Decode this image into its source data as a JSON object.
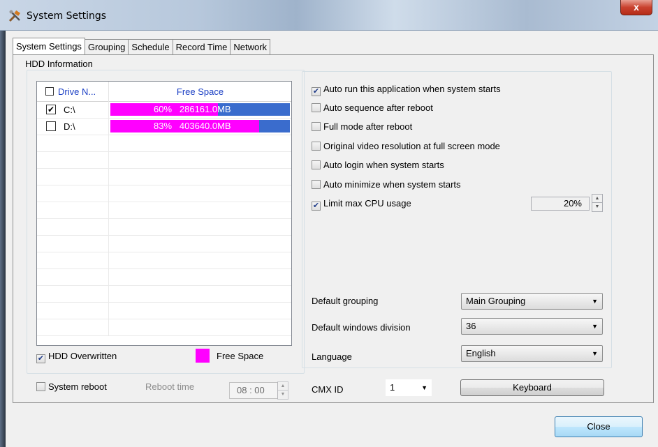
{
  "window": {
    "title": "System Settings",
    "close_glyph": "x"
  },
  "tabs": [
    {
      "label": "System Settings",
      "active": true
    },
    {
      "label": "Grouping"
    },
    {
      "label": "Schedule"
    },
    {
      "label": "Record Time"
    },
    {
      "label": "Network"
    }
  ],
  "hdd": {
    "group_title": "HDD Information",
    "columns": [
      "Drive N...",
      "Free Space"
    ],
    "rows": [
      {
        "checked": true,
        "drive": "C:\\",
        "percent_label": "60%",
        "size_label": "286161.0MB",
        "fill_fraction": 0.6
      },
      {
        "checked": false,
        "drive": "D:\\",
        "percent_label": "83%",
        "size_label": "403640.0MB",
        "fill_fraction": 0.83
      }
    ],
    "overwritten_label": "HDD Overwritten",
    "overwritten_checked": true,
    "legend_label": "Free Space",
    "legend_color": "#ff00ff",
    "bar_color": "#3a6ccd"
  },
  "options": [
    {
      "label": "Auto run this application when system starts",
      "checked": true
    },
    {
      "label": "Auto sequence after reboot",
      "checked": false
    },
    {
      "label": "Full mode after reboot",
      "checked": false
    },
    {
      "label": "Original video resolution at full screen mode",
      "checked": false
    },
    {
      "label": "Auto login when system starts",
      "checked": false
    },
    {
      "label": "Auto minimize when system starts",
      "checked": false
    },
    {
      "label": "Limit max CPU usage",
      "checked": true
    }
  ],
  "cpu_limit": "20%",
  "defaults": {
    "grouping_label": "Default grouping",
    "grouping_value": "Main Grouping",
    "division_label": "Default windows division",
    "division_value": "36",
    "language_label": "Language",
    "language_value": "English"
  },
  "footer": {
    "reboot_label": "System reboot",
    "reboot_checked": false,
    "reboot_time_label": "Reboot time",
    "reboot_time_value": "08 : 00",
    "cmx_label": "CMX ID",
    "cmx_value": "1",
    "keyboard_label": "Keyboard",
    "close_label": "Close"
  }
}
